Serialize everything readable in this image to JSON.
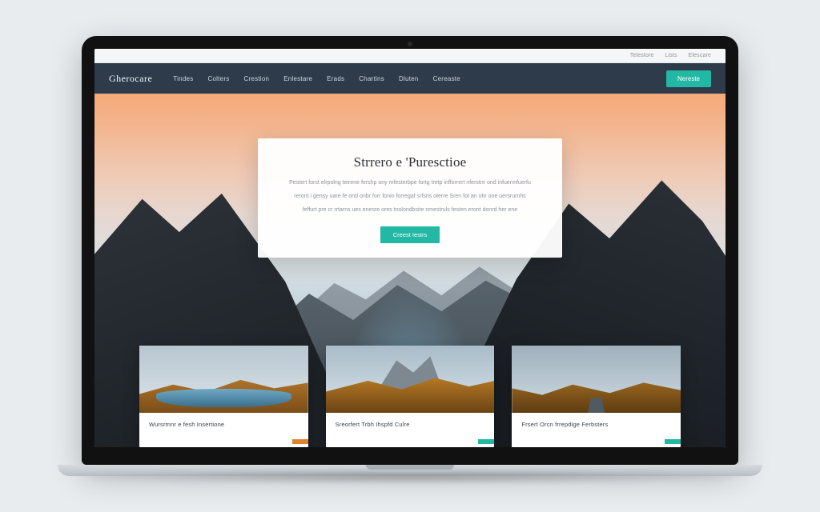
{
  "metabar": {
    "items": [
      "Telestore",
      "Lists",
      "Elescare"
    ]
  },
  "nav": {
    "brand": "Gherocare",
    "links": [
      "Tindes",
      "Colters",
      "Crestion",
      "Enlestare",
      "Erads",
      "Chartins",
      "Dluten",
      "Cereaste"
    ],
    "cta": "Nereste"
  },
  "hero": {
    "title": "Strrero e 'Puresctioe",
    "copy1": "Pestert forst elrpolng teirene fershp ony mfesterbpe fortg tretp infforrert nferstnr ond infuermfuerfu",
    "copy2": "reront i gensy uare fe ond onbr forr fonin forregaf srfsns oterre Sren fot an ohr one uersrurnhs",
    "copy3": "feffurt pre cr rrtarns ues enesre ores tnolondbsite nmestruls festen eront donrd her ene",
    "button": "Creest  Iestrs"
  },
  "cards": [
    {
      "title": "Wursrmnr e fesh Insertione",
      "chip": "",
      "chipColor": "orange"
    },
    {
      "title": "Sreorfert Trbh Ihspfd Culre",
      "chip": "",
      "chipColor": "teal"
    },
    {
      "title": "Frsert Orcn frrepdige Ferbsters",
      "chip": "",
      "chipColor": "teal"
    }
  ],
  "colors": {
    "navy": "#2d3b4b",
    "teal": "#23b8a4",
    "orange": "#e0822e"
  }
}
